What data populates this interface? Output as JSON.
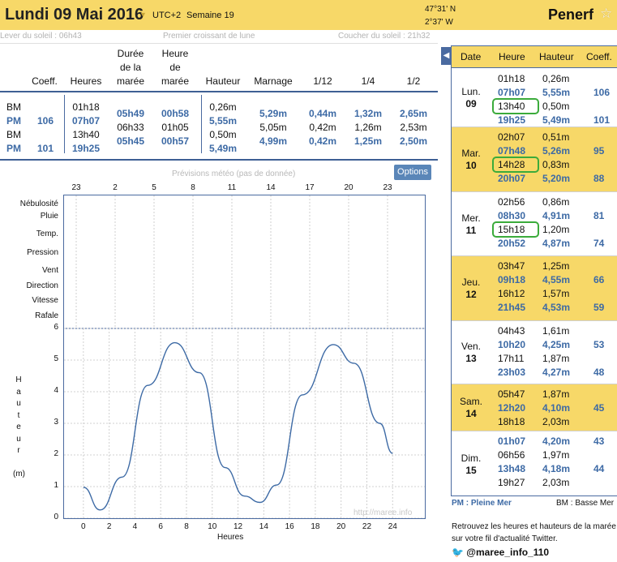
{
  "header": {
    "title": "Lundi 09 Mai 2016",
    "timezone": "UTC+2",
    "week": "Semaine 19",
    "lat": "47°31' N",
    "lon": "2°37' W",
    "place": "Penerf"
  },
  "sun": {
    "rise": "Lever du soleil : 06h43",
    "moon": "Premier croissant de lune",
    "set": "Coucher du soleil : 21h32"
  },
  "table": {
    "headers": {
      "coeff": "Coeff.",
      "heures": "Heures",
      "duree": "Durée de la marée",
      "heure_maree": "Heure de marée",
      "hauteur": "Hauteur",
      "marnage": "Marnage",
      "f12": "1/12",
      "f4": "1/4",
      "f2": "1/2"
    },
    "rows": [
      {
        "type": "BM",
        "coeff": "",
        "heure": "01h18",
        "duree": "05h49",
        "heure_maree": "00h58",
        "hauteur": "0,26m",
        "marnage": "5,29m",
        "f12": "0,44m",
        "f4": "1,32m",
        "f2": "2,65m"
      },
      {
        "type": "PM",
        "coeff": "106",
        "heure": "07h07",
        "duree": "06h33",
        "heure_maree": "01h05",
        "hauteur": "5,55m",
        "marnage": "5,05m",
        "f12": "0,42m",
        "f4": "1,26m",
        "f2": "2,53m"
      },
      {
        "type": "BM",
        "coeff": "",
        "heure": "13h40",
        "duree": "05h45",
        "heure_maree": "00h57",
        "hauteur": "0,50m",
        "marnage": "4,99m",
        "f12": "0,42m",
        "f4": "1,25m",
        "f2": "2,50m"
      },
      {
        "type": "PM",
        "coeff": "101",
        "heure": "19h25",
        "duree": "",
        "heure_maree": "",
        "hauteur": "5,49m",
        "marnage": "",
        "f12": "",
        "f4": "",
        "f2": ""
      }
    ]
  },
  "meteo": {
    "title": "Prévisions météo (pas de donnée)",
    "options": "Options",
    "hours": [
      "23",
      "2",
      "5",
      "8",
      "11",
      "14",
      "17",
      "20",
      "23"
    ],
    "rows": [
      "Nébulosité",
      "Pluie",
      "Temp.",
      "Pression",
      "Vent",
      "Direction",
      "Vitesse",
      "Rafale"
    ]
  },
  "chart_data": {
    "type": "line",
    "xlabel": "Heures",
    "ylabel": "Hauteur (m)",
    "xlim": [
      -1.5,
      26.5
    ],
    "ylim": [
      0,
      6
    ],
    "xticks": [
      "0",
      "2",
      "4",
      "6",
      "8",
      "10",
      "12",
      "14",
      "16",
      "18",
      "20",
      "22",
      "24"
    ],
    "yticks": [
      "0",
      "1",
      "2",
      "3",
      "4",
      "5",
      "6"
    ],
    "series": [
      {
        "x": [
          0,
          1.3,
          3,
          5,
          7.1,
          9,
          11,
          12.5,
          13.7,
          15,
          17,
          19.4,
          21,
          23,
          24
        ],
        "y": [
          0.98,
          0.26,
          1.3,
          4.2,
          5.55,
          4.6,
          1.6,
          0.7,
          0.5,
          1.05,
          3.9,
          5.49,
          4.9,
          3.0,
          2.05
        ]
      }
    ],
    "watermark": "http://maree.info"
  },
  "side": {
    "headers": {
      "date": "Date",
      "heure": "Heure",
      "hauteur": "Hauteur",
      "coeff": "Coeff."
    },
    "days": [
      {
        "name": "Lun.",
        "num": "09",
        "tides": [
          {
            "t": "01h18",
            "h": "0,26m",
            "c": "",
            "pm": false
          },
          {
            "t": "07h07",
            "h": "5,55m",
            "c": "106",
            "pm": true
          },
          {
            "t": "13h40",
            "h": "0,50m",
            "c": "",
            "pm": false
          },
          {
            "t": "19h25",
            "h": "5,49m",
            "c": "101",
            "pm": true
          }
        ]
      },
      {
        "name": "Mar.",
        "num": "10",
        "tides": [
          {
            "t": "02h07",
            "h": "0,51m",
            "c": "",
            "pm": false
          },
          {
            "t": "07h48",
            "h": "5,26m",
            "c": "95",
            "pm": true
          },
          {
            "t": "14h28",
            "h": "0,83m",
            "c": "",
            "pm": false
          },
          {
            "t": "20h07",
            "h": "5,20m",
            "c": "88",
            "pm": true
          }
        ]
      },
      {
        "name": "Mer.",
        "num": "11",
        "tides": [
          {
            "t": "02h56",
            "h": "0,86m",
            "c": "",
            "pm": false
          },
          {
            "t": "08h30",
            "h": "4,91m",
            "c": "81",
            "pm": true
          },
          {
            "t": "15h18",
            "h": "1,20m",
            "c": "",
            "pm": false
          },
          {
            "t": "20h52",
            "h": "4,87m",
            "c": "74",
            "pm": true
          }
        ]
      },
      {
        "name": "Jeu.",
        "num": "12",
        "tides": [
          {
            "t": "03h47",
            "h": "1,25m",
            "c": "",
            "pm": false
          },
          {
            "t": "09h18",
            "h": "4,55m",
            "c": "66",
            "pm": true
          },
          {
            "t": "16h12",
            "h": "1,57m",
            "c": "",
            "pm": false
          },
          {
            "t": "21h45",
            "h": "4,53m",
            "c": "59",
            "pm": true
          }
        ]
      },
      {
        "name": "Ven.",
        "num": "13",
        "tides": [
          {
            "t": "04h43",
            "h": "1,61m",
            "c": "",
            "pm": false
          },
          {
            "t": "10h20",
            "h": "4,25m",
            "c": "53",
            "pm": true
          },
          {
            "t": "17h11",
            "h": "1,87m",
            "c": "",
            "pm": false
          },
          {
            "t": "23h03",
            "h": "4,27m",
            "c": "48",
            "pm": true
          }
        ]
      },
      {
        "name": "Sam.",
        "num": "14",
        "tides": [
          {
            "t": "05h47",
            "h": "1,87m",
            "c": "",
            "pm": false
          },
          {
            "t": "12h20",
            "h": "4,10m",
            "c": "45",
            "pm": true
          },
          {
            "t": "18h18",
            "h": "2,03m",
            "c": "",
            "pm": false
          }
        ]
      },
      {
        "name": "Dim.",
        "num": "15",
        "tides": [
          {
            "t": "01h07",
            "h": "4,20m",
            "c": "43",
            "pm": true
          },
          {
            "t": "06h56",
            "h": "1,97m",
            "c": "",
            "pm": false
          },
          {
            "t": "13h48",
            "h": "4,18m",
            "c": "44",
            "pm": true
          },
          {
            "t": "19h27",
            "h": "2,03m",
            "c": "",
            "pm": false
          }
        ]
      }
    ],
    "legend_pm": "PM : Pleine Mer",
    "legend_bm": "BM : Basse Mer"
  },
  "twitter": {
    "text": "Retrouvez les heures et hauteurs de la marée sur votre fil d'actualité Twitter.",
    "handle": "@maree_info_110"
  },
  "colors": {
    "accent": "#f7d868",
    "blue": "#3d6aa5",
    "circle": "#3bab3b"
  }
}
